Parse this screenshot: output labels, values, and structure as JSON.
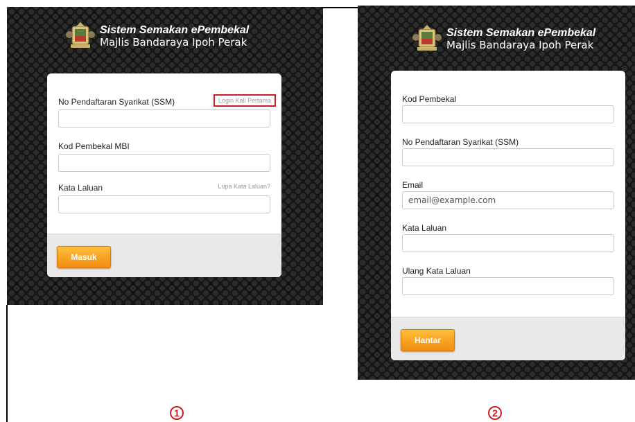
{
  "header": {
    "title": "Sistem Semakan ePembekal",
    "subtitle": "Majlis Bandaraya Ipoh Perak"
  },
  "login_form": {
    "ssm_label": "No Pendaftaran Syarikat (SSM)",
    "first_login_link": "Login Kali Pertama",
    "supplier_code_label": "Kod Pembekal MBI",
    "password_label": "Kata Laluan",
    "forgot_password_link": "Lupa Kata Laluan?",
    "submit_label": "Masuk"
  },
  "register_form": {
    "supplier_code_label": "Kod Pembekal",
    "ssm_label": "No Pendaftaran Syarikat (SSM)",
    "email_label": "Email",
    "email_placeholder": "email@example.com",
    "password_label": "Kata Laluan",
    "confirm_password_label": "Ulang Kata Laluan",
    "submit_label": "Hantar"
  },
  "step_markers": [
    "1",
    "2"
  ],
  "colors": {
    "button": "#f39a17",
    "highlight_box": "#cc1f1f",
    "background": "#1b1b1b"
  }
}
